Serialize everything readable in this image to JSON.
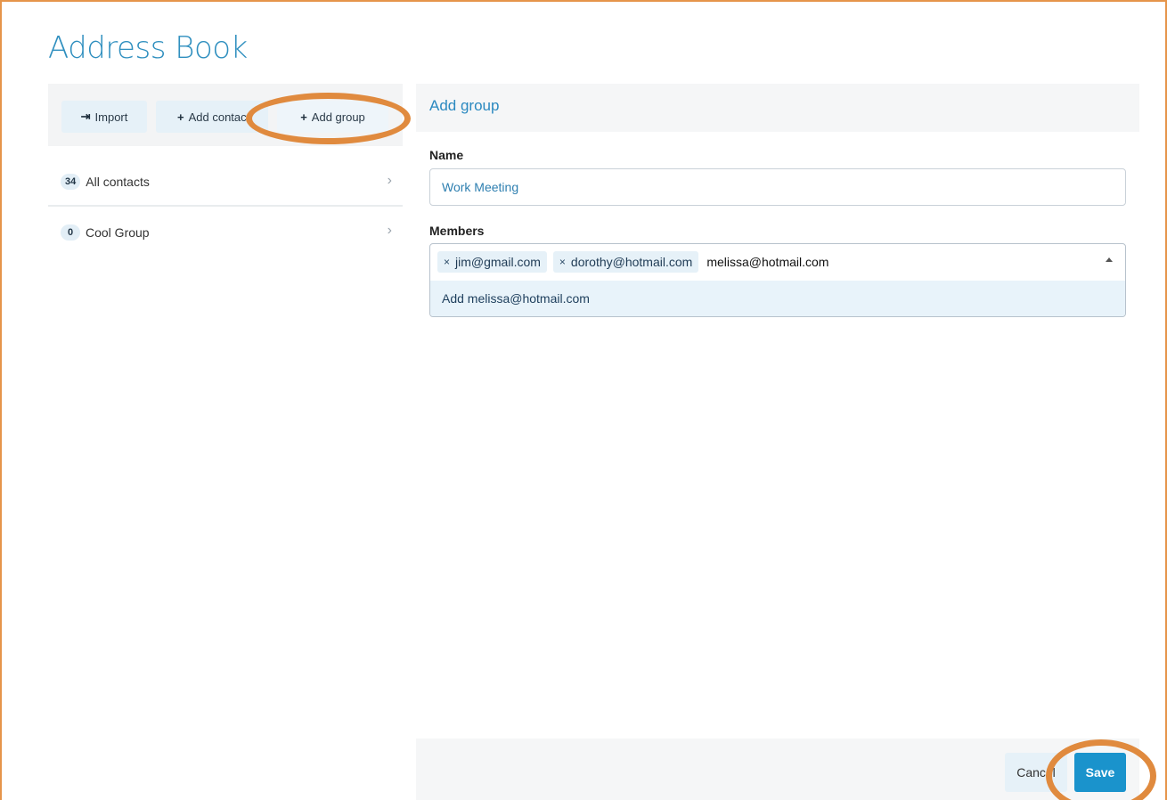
{
  "app": {
    "title": "Address Book"
  },
  "toolbar": {
    "import_label": "Import",
    "add_contact_label": "Add contact",
    "add_group_label": "Add group",
    "import_icon": "sign-in-icon",
    "plus_icon": "plus-icon"
  },
  "sidebar": {
    "items": [
      {
        "count": "34",
        "label": "All contacts"
      },
      {
        "count": "0",
        "label": "Cool Group"
      }
    ]
  },
  "form": {
    "title": "Add group",
    "name_label": "Name",
    "name_value": "Work Meeting",
    "members_label": "Members",
    "members": [
      {
        "email": "jim@gmail.com"
      },
      {
        "email": "dorothy@hotmail.com"
      }
    ],
    "members_typed": "melissa@hotmail.com",
    "suggestion": "Add melissa@hotmail.com",
    "remove_symbol": "×"
  },
  "footer": {
    "cancel_label": "Cancel",
    "save_label": "Save"
  },
  "colors": {
    "accent": "#2f8fbf",
    "save_button": "#1a93cc",
    "annotation": "#e08a3e"
  }
}
